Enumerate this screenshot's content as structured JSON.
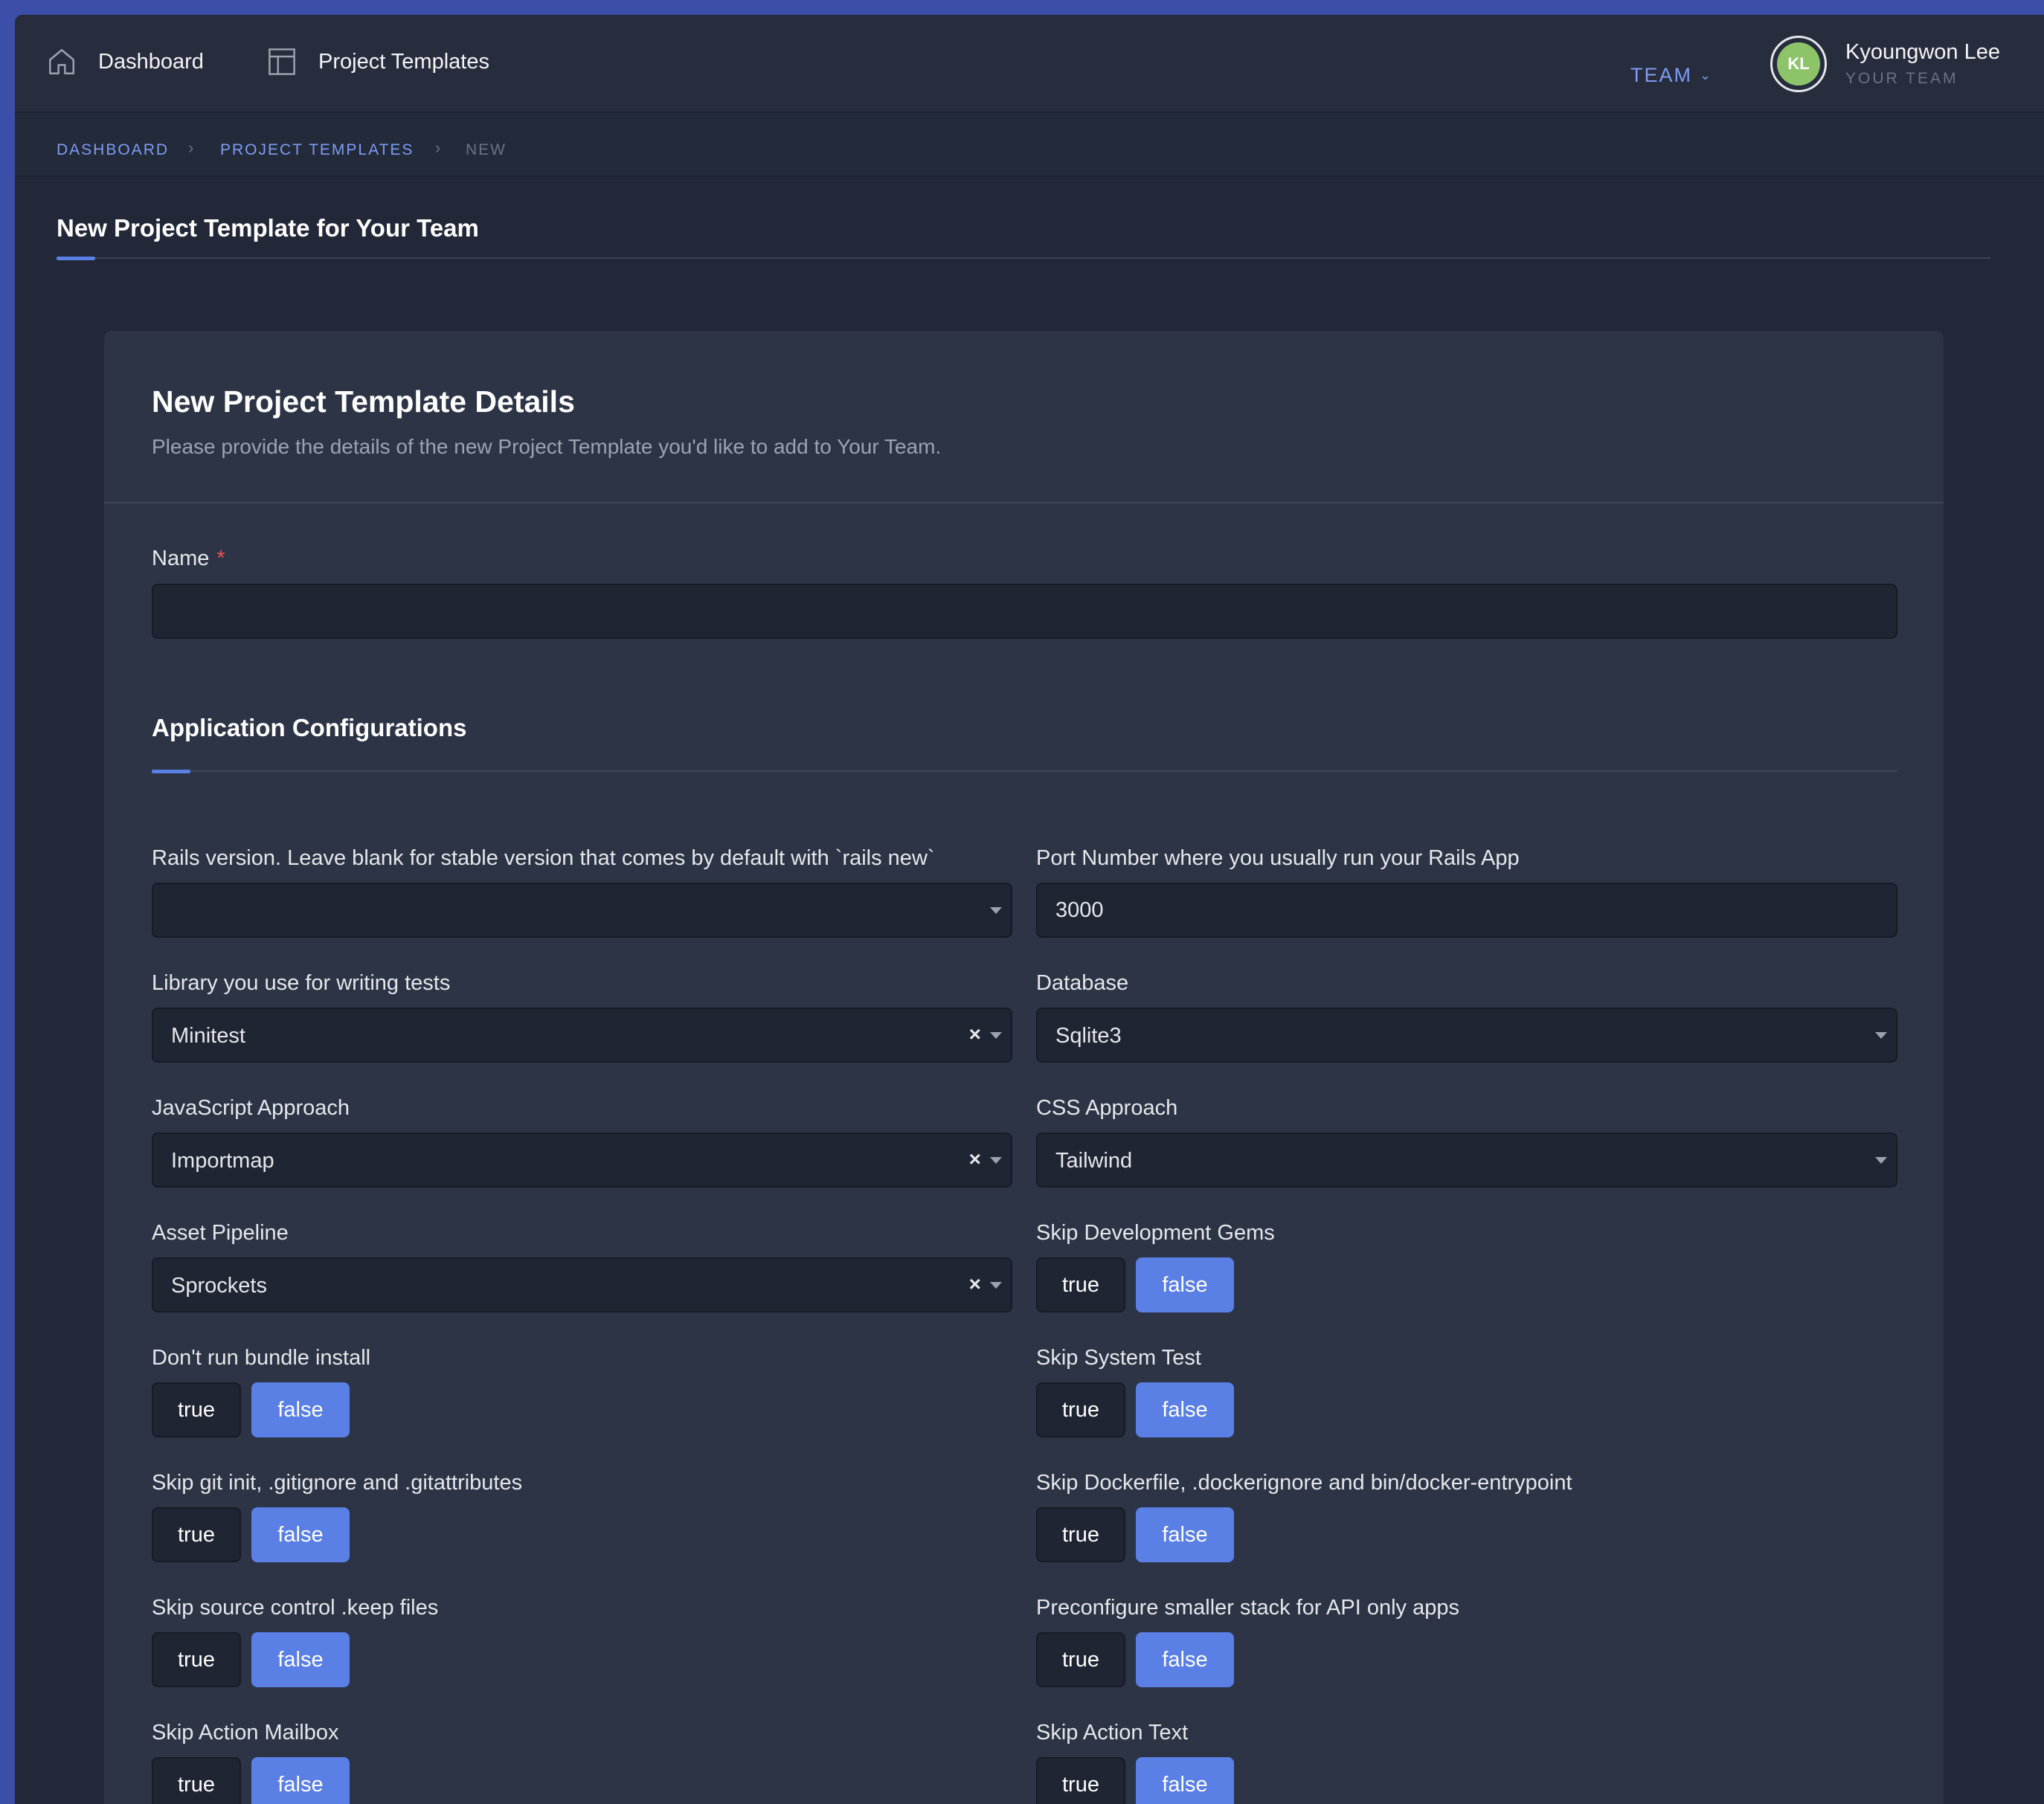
{
  "nav": {
    "dashboard_label": "Dashboard",
    "templates_label": "Project Templates",
    "team_label": "TEAM",
    "user_initials": "KL",
    "user_name": "Kyoungwon Lee",
    "user_team": "YOUR TEAM"
  },
  "breadcrumb": [
    "DASHBOARD",
    "PROJECT TEMPLATES",
    "NEW"
  ],
  "page_title": "New Project Template for Your Team",
  "card": {
    "title": "New Project Template Details",
    "subtitle": "Please provide the details of the new Project Template you'd like to add to Your Team."
  },
  "name_field": {
    "label": "Name",
    "required_mark": "*",
    "value": ""
  },
  "section_title": "Application Configurations",
  "fields": {
    "rails_version": {
      "label": "Rails version. Leave blank for stable version that comes by default with `rails new`",
      "value": ""
    },
    "port": {
      "label": "Port Number where you usually run your Rails App",
      "value": "3000"
    },
    "test_lib": {
      "label": "Library you use for writing tests",
      "value": "Minitest"
    },
    "database": {
      "label": "Database",
      "value": "Sqlite3"
    },
    "js": {
      "label": "JavaScript Approach",
      "value": "Importmap"
    },
    "css": {
      "label": "CSS Approach",
      "value": "Tailwind"
    },
    "asset": {
      "label": "Asset Pipeline",
      "value": "Sprockets"
    }
  },
  "toggles": {
    "true_label": "true",
    "false_label": "false",
    "skip_dev_gems": {
      "label": "Skip Development Gems",
      "selected": "false"
    },
    "no_bundle": {
      "label": "Don't run bundle install",
      "selected": "false"
    },
    "skip_system_test": {
      "label": "Skip System Test",
      "selected": "false"
    },
    "skip_git": {
      "label": "Skip git init, .gitignore and .gitattributes",
      "selected": "false"
    },
    "skip_docker": {
      "label": "Skip Dockerfile, .dockerignore and bin/docker-entrypoint",
      "selected": "false"
    },
    "skip_keep": {
      "label": "Skip source control .keep files",
      "selected": "false"
    },
    "api_only": {
      "label": "Preconfigure smaller stack for API only apps",
      "selected": "false"
    },
    "skip_mailbox": {
      "label": "Skip Action Mailbox",
      "selected": "false"
    },
    "skip_text": {
      "label": "Skip Action Text",
      "selected": "false"
    }
  },
  "colors": {
    "accent": "#5a7fe5",
    "link": "#7f9cf5",
    "required": "#ef5350",
    "avatar": "#8dc46a"
  },
  "icons": [
    "home-icon",
    "layout-icon",
    "chevron-down-icon",
    "close-icon",
    "caret-down-icon"
  ]
}
